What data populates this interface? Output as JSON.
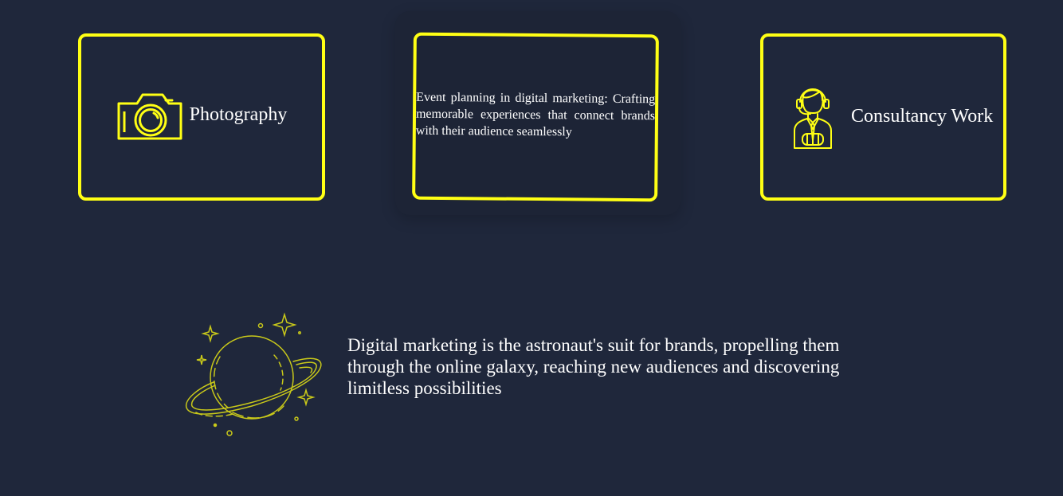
{
  "colors": {
    "background": "#1f273b",
    "accent": "#ffff14",
    "text": "#ffffff"
  },
  "services": {
    "photography": {
      "icon": "camera-icon",
      "label": "Photography"
    },
    "event": {
      "description": "Event planning in digital marketing: Crafting memorable experiences that connect brands with their audience seamlessly"
    },
    "consultancy": {
      "icon": "consultant-icon",
      "label": "Consultancy Work"
    }
  },
  "tagline": {
    "icon": "planet-icon",
    "text": "Digital marketing is the astronaut's suit for brands, propelling them through the online galaxy, reaching new audiences and discovering limitless possibilities"
  }
}
